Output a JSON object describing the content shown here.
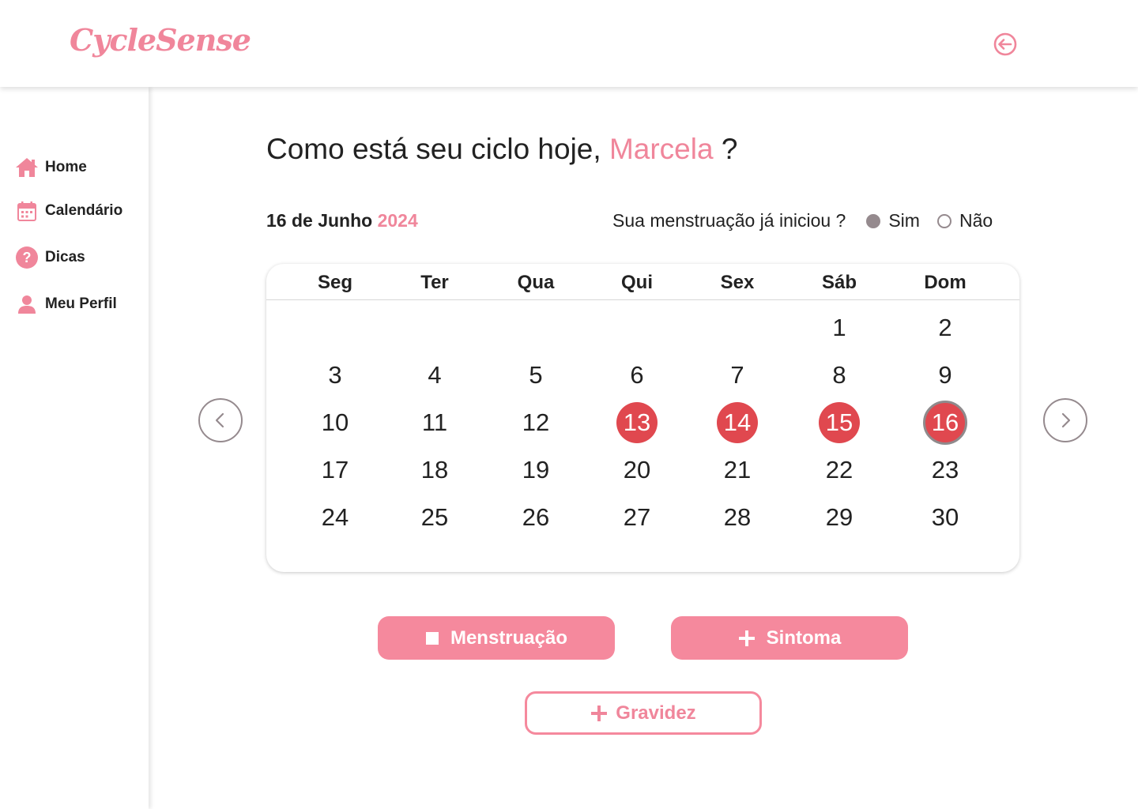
{
  "app": {
    "logo": "CycleSense"
  },
  "header": {
    "logout_icon": "logout-icon"
  },
  "sidebar": {
    "items": [
      {
        "label": "Home",
        "icon": "home-icon"
      },
      {
        "label": "Calendário",
        "icon": "calendar-icon"
      },
      {
        "label": "Dicas",
        "icon": "help-icon"
      },
      {
        "label": "Meu Perfil",
        "icon": "user-icon"
      }
    ]
  },
  "main": {
    "greeting_prefix": "Como está seu ciclo hoje,",
    "user_name": "Marcela",
    "greeting_suffix": "?",
    "date_text": "16 de Junho",
    "year": "2024",
    "question": "Sua menstruação já iniciou ?",
    "options": {
      "yes": "Sim",
      "no": "Não",
      "selected": "Sim"
    }
  },
  "calendar": {
    "weekdays": [
      "Seg",
      "Ter",
      "Qua",
      "Qui",
      "Sex",
      "Sáb",
      "Dom"
    ],
    "weeks": [
      [
        "",
        "",
        "",
        "",
        "",
        "1",
        "2"
      ],
      [
        "3",
        "4",
        "5",
        "6",
        "7",
        "8",
        "9"
      ],
      [
        "10",
        "11",
        "12",
        "13",
        "14",
        "15",
        "16"
      ],
      [
        "17",
        "18",
        "19",
        "20",
        "21",
        "22",
        "23"
      ],
      [
        "24",
        "25",
        "26",
        "27",
        "28",
        "29",
        "30"
      ]
    ],
    "period_days": [
      "13",
      "14",
      "15"
    ],
    "today": "16",
    "period_color": "#e0484f"
  },
  "actions": {
    "menstruation": "Menstruação",
    "symptom": "Sintoma",
    "pregnancy": "Gravidez"
  },
  "colors": {
    "accent": "#f0869b",
    "button": "#f5899d",
    "muted": "#958a8e"
  }
}
